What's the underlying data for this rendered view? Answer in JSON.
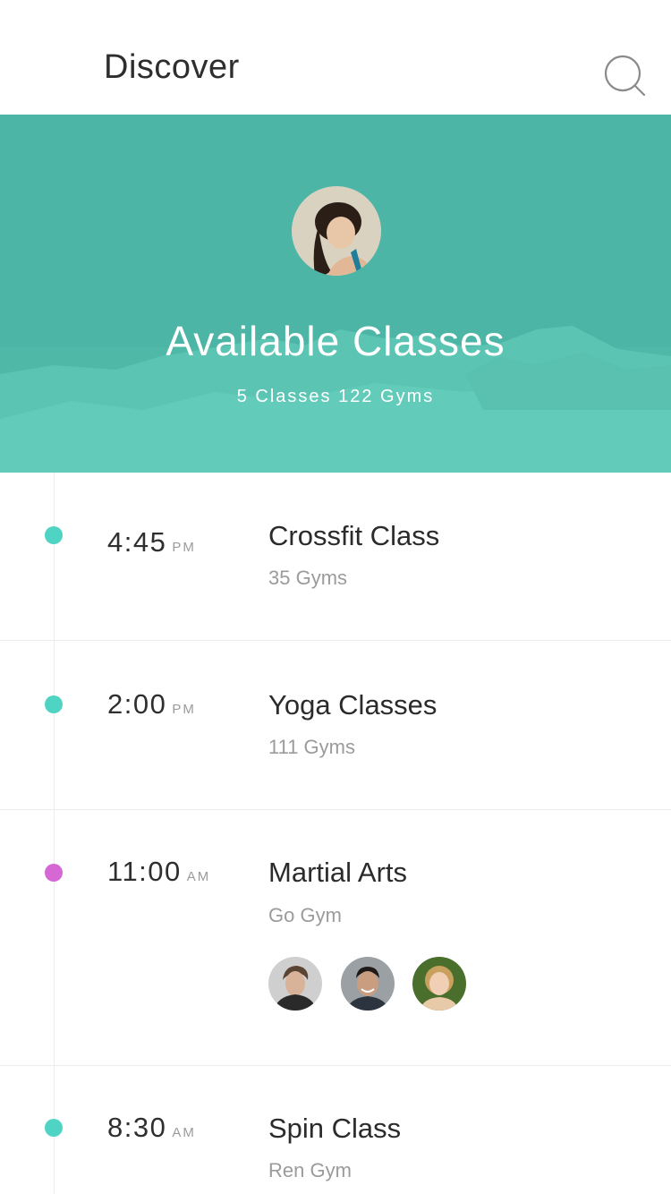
{
  "header": {
    "title": "Discover",
    "search_icon": "search-icon"
  },
  "hero": {
    "title": "Available Classes",
    "subtitle": "5 Classes 122 Gyms",
    "background_color": "#4fb8a7",
    "avatar_icon": "user-avatar"
  },
  "classes": [
    {
      "time": "4:45",
      "period": "PM",
      "name": "Crossfit Class",
      "subtitle": "35 Gyms",
      "dot_color": "#4fd3c3"
    },
    {
      "time": "2:00",
      "period": "PM",
      "name": "Yoga Classes",
      "subtitle": "111 Gyms",
      "dot_color": "#4fd3c3"
    },
    {
      "time": "11:00",
      "period": "AM",
      "name": "Martial Arts",
      "subtitle": "Go Gym",
      "dot_color": "#d668d6"
    },
    {
      "time": "8:30",
      "period": "AM",
      "name": "Spin Class",
      "subtitle": "Ren Gym",
      "dot_color": "#4fd3c3"
    }
  ],
  "attendees": [
    "attendee-avatar-1",
    "attendee-avatar-2",
    "attendee-avatar-3"
  ]
}
